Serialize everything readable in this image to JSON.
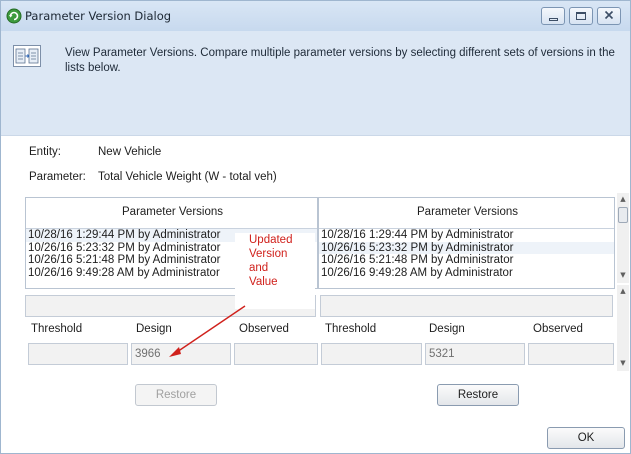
{
  "window": {
    "title": "Parameter Version Dialog"
  },
  "header": {
    "description": "View Parameter Versions.  Compare multiple parameter versions by selecting different sets of versions in the lists below."
  },
  "fields": {
    "entity_label": "Entity:",
    "entity_value": "New Vehicle",
    "parameter_label": "Parameter:",
    "parameter_value": "Total Vehicle Weight (W - total veh)"
  },
  "left_panel": {
    "title": "Parameter Versions",
    "versions": [
      "10/28/16 1:29:44 PM by Administrator",
      "10/26/16 5:23:32 PM by Administrator",
      "10/26/16 5:21:48 PM by Administrator",
      "10/26/16 9:49:28 AM by Administrator"
    ],
    "selected_index": 0,
    "columns": [
      "Threshold",
      "Design",
      "Observed"
    ],
    "threshold_value": "",
    "design_value": "3966",
    "observed_value": "",
    "restore_label": "Restore",
    "restore_enabled": false
  },
  "right_panel": {
    "title": "Parameter Versions",
    "versions": [
      "10/28/16 1:29:44 PM by Administrator",
      "10/26/16 5:23:32 PM by Administrator",
      "10/26/16 5:21:48 PM by Administrator",
      "10/26/16 9:49:28 AM by Administrator"
    ],
    "selected_index": 1,
    "columns": [
      "Threshold",
      "Design",
      "Observed"
    ],
    "threshold_value": "",
    "design_value": "5321",
    "observed_value": "",
    "restore_label": "Restore",
    "restore_enabled": true
  },
  "annotation": {
    "lines": [
      "Updated",
      "Version",
      "and",
      "Value"
    ],
    "color": "#d0211c"
  },
  "footer": {
    "ok_label": "OK"
  },
  "colors": {
    "title_bar": "#c7d9ee",
    "header_band": "#dce7f4",
    "selection": "#eef3f9"
  },
  "icons": {
    "title": "app-refresh-icon",
    "header": "compare-versions-icon",
    "minimize": "minimize-icon",
    "maximize": "maximize-icon",
    "close": "close-icon"
  }
}
